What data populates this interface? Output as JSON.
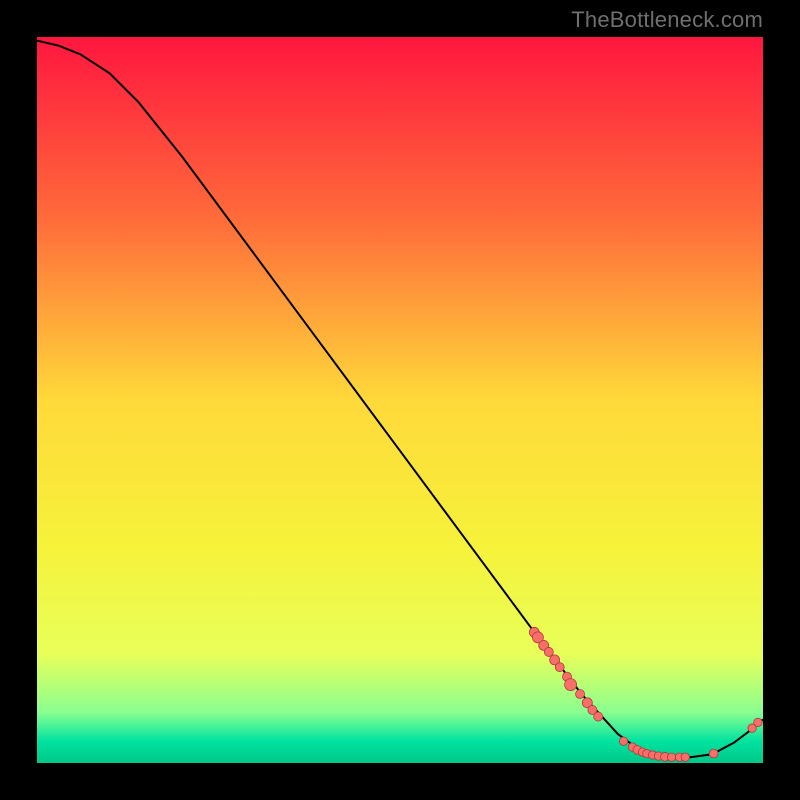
{
  "watermark": "TheBottleneck.com",
  "chart_data": {
    "type": "line",
    "title": "",
    "xlabel": "",
    "ylabel": "",
    "xlim": [
      0,
      100
    ],
    "ylim": [
      0,
      100
    ],
    "grid": false,
    "gradient_stops": [
      {
        "offset": 0,
        "color": "#ff163f"
      },
      {
        "offset": 0.25,
        "color": "#ff6b3a"
      },
      {
        "offset": 0.5,
        "color": "#ffd93a"
      },
      {
        "offset": 0.7,
        "color": "#f6f23a"
      },
      {
        "offset": 0.85,
        "color": "#e8ff59"
      },
      {
        "offset": 0.93,
        "color": "#8aff90"
      },
      {
        "offset": 0.97,
        "color": "#00e3a0"
      },
      {
        "offset": 1.0,
        "color": "#00c888"
      }
    ],
    "curve": [
      {
        "x": 0.0,
        "y": 99.5
      },
      {
        "x": 3.0,
        "y": 98.8
      },
      {
        "x": 6.0,
        "y": 97.6
      },
      {
        "x": 10.0,
        "y": 95.0
      },
      {
        "x": 14.0,
        "y": 91.0
      },
      {
        "x": 20.0,
        "y": 83.5
      },
      {
        "x": 30.0,
        "y": 70.0
      },
      {
        "x": 40.0,
        "y": 56.5
      },
      {
        "x": 50.0,
        "y": 43.0
      },
      {
        "x": 60.0,
        "y": 29.5
      },
      {
        "x": 70.0,
        "y": 16.0
      },
      {
        "x": 75.0,
        "y": 9.5
      },
      {
        "x": 80.0,
        "y": 4.0
      },
      {
        "x": 83.0,
        "y": 1.8
      },
      {
        "x": 86.0,
        "y": 0.8
      },
      {
        "x": 90.0,
        "y": 0.8
      },
      {
        "x": 93.0,
        "y": 1.2
      },
      {
        "x": 96.0,
        "y": 2.8
      },
      {
        "x": 98.0,
        "y": 4.3
      },
      {
        "x": 100.0,
        "y": 6.0
      }
    ],
    "markers": [
      {
        "x": 68.5,
        "y": 18.0,
        "r": 5.0
      },
      {
        "x": 69.0,
        "y": 17.3,
        "r": 5.5
      },
      {
        "x": 69.8,
        "y": 16.2,
        "r": 5.0
      },
      {
        "x": 70.5,
        "y": 15.3,
        "r": 4.5
      },
      {
        "x": 71.3,
        "y": 14.2,
        "r": 5.0
      },
      {
        "x": 72.0,
        "y": 13.2,
        "r": 4.5
      },
      {
        "x": 73.0,
        "y": 11.9,
        "r": 4.5
      },
      {
        "x": 73.5,
        "y": 10.8,
        "r": 6.0
      },
      {
        "x": 74.8,
        "y": 9.5,
        "r": 4.5
      },
      {
        "x": 75.8,
        "y": 8.3,
        "r": 5.0
      },
      {
        "x": 76.5,
        "y": 7.3,
        "r": 4.5
      },
      {
        "x": 77.3,
        "y": 6.4,
        "r": 4.5
      },
      {
        "x": 80.8,
        "y": 3.0,
        "r": 4.2
      },
      {
        "x": 82.0,
        "y": 2.2,
        "r": 4.2
      },
      {
        "x": 82.7,
        "y": 1.8,
        "r": 4.4
      },
      {
        "x": 83.4,
        "y": 1.5,
        "r": 4.2
      },
      {
        "x": 84.0,
        "y": 1.3,
        "r": 4.2
      },
      {
        "x": 84.8,
        "y": 1.1,
        "r": 4.2
      },
      {
        "x": 85.6,
        "y": 0.95,
        "r": 4.2
      },
      {
        "x": 86.5,
        "y": 0.85,
        "r": 4.4
      },
      {
        "x": 87.4,
        "y": 0.8,
        "r": 4.2
      },
      {
        "x": 88.5,
        "y": 0.8,
        "r": 4.2
      },
      {
        "x": 89.3,
        "y": 0.8,
        "r": 4.2
      },
      {
        "x": 93.2,
        "y": 1.3,
        "r": 4.4
      },
      {
        "x": 98.5,
        "y": 4.8,
        "r": 4.2
      },
      {
        "x": 99.3,
        "y": 5.6,
        "r": 4.2
      }
    ],
    "line_color": "#000000",
    "marker_fill": "#fa6e6a",
    "marker_stroke": "#aa3c3c"
  }
}
